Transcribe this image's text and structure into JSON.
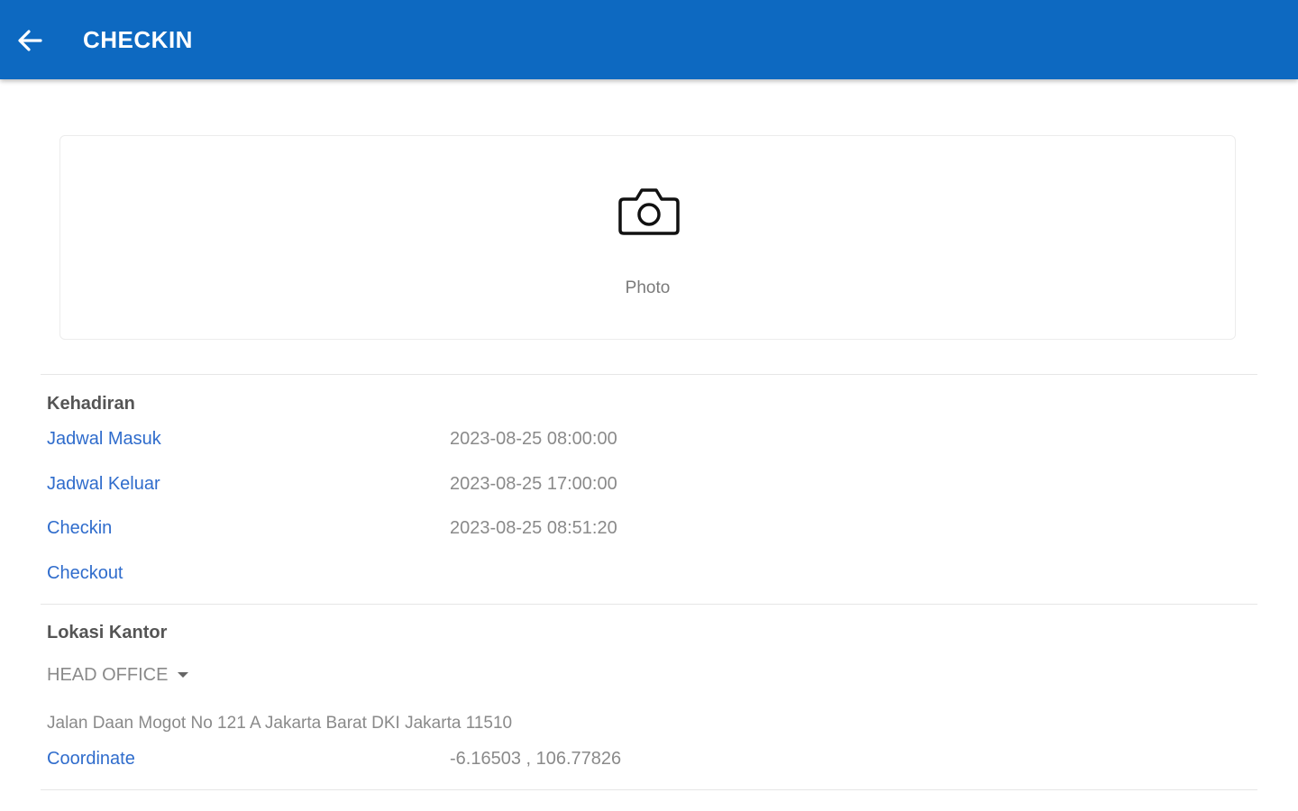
{
  "appbar": {
    "title": "CHECKIN",
    "back_icon": "arrow-left-icon",
    "color": "#0d69c1"
  },
  "photo": {
    "label": "Photo",
    "icon": "camera-icon"
  },
  "kehadiran": {
    "title": "Kehadiran",
    "rows": [
      {
        "label": "Jadwal Masuk",
        "value": "2023-08-25 08:00:00"
      },
      {
        "label": "Jadwal Keluar",
        "value": "2023-08-25 17:00:00"
      },
      {
        "label": "Checkin",
        "value": "2023-08-25 08:51:20"
      },
      {
        "label": "Checkout",
        "value": ""
      }
    ]
  },
  "lokasi": {
    "title": "Lokasi Kantor",
    "office_selected": "HEAD OFFICE",
    "address": "Jalan Daan Mogot No 121 A Jakarta Barat DKI Jakarta 11510",
    "coordinate_label": "Coordinate",
    "coordinate_value": "-6.16503 , 106.77826"
  },
  "colors": {
    "label_blue": "#2f6ccc",
    "value_gray": "#8a8a8a"
  }
}
